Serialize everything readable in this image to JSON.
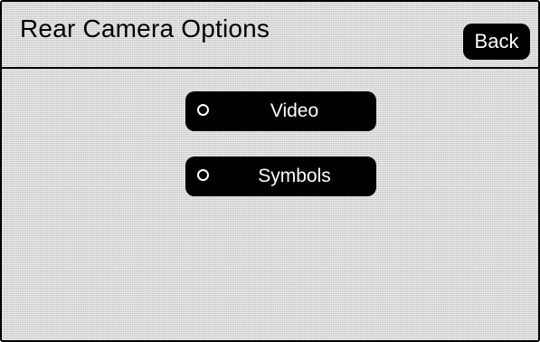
{
  "header": {
    "title": "Rear Camera Options",
    "back_label": "Back"
  },
  "options": [
    {
      "label": "Video",
      "selected": false,
      "icon": "radio-unselected-icon"
    },
    {
      "label": "Symbols",
      "selected": false,
      "icon": "radio-unselected-icon"
    }
  ],
  "colors": {
    "background": "#d9d9d9",
    "button": "#000000",
    "button_text": "#ffffff"
  }
}
